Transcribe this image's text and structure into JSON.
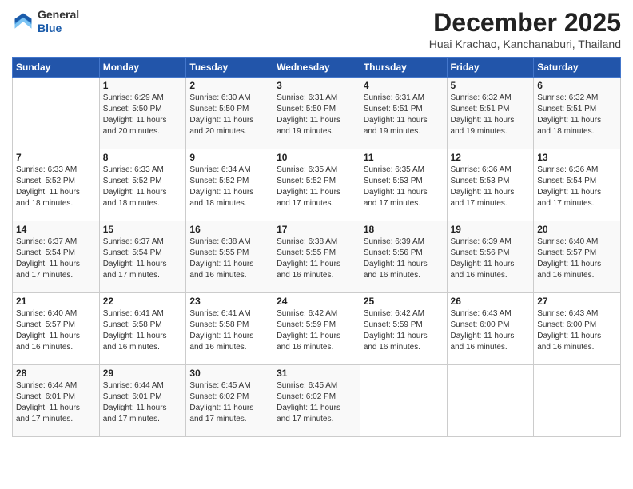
{
  "header": {
    "logo_general": "General",
    "logo_blue": "Blue",
    "month_title": "December 2025",
    "location": "Huai Krachao, Kanchanaburi, Thailand"
  },
  "days_of_week": [
    "Sunday",
    "Monday",
    "Tuesday",
    "Wednesday",
    "Thursday",
    "Friday",
    "Saturday"
  ],
  "weeks": [
    [
      {
        "day": "",
        "info": ""
      },
      {
        "day": "1",
        "info": "Sunrise: 6:29 AM\nSunset: 5:50 PM\nDaylight: 11 hours\nand 20 minutes."
      },
      {
        "day": "2",
        "info": "Sunrise: 6:30 AM\nSunset: 5:50 PM\nDaylight: 11 hours\nand 20 minutes."
      },
      {
        "day": "3",
        "info": "Sunrise: 6:31 AM\nSunset: 5:50 PM\nDaylight: 11 hours\nand 19 minutes."
      },
      {
        "day": "4",
        "info": "Sunrise: 6:31 AM\nSunset: 5:51 PM\nDaylight: 11 hours\nand 19 minutes."
      },
      {
        "day": "5",
        "info": "Sunrise: 6:32 AM\nSunset: 5:51 PM\nDaylight: 11 hours\nand 19 minutes."
      },
      {
        "day": "6",
        "info": "Sunrise: 6:32 AM\nSunset: 5:51 PM\nDaylight: 11 hours\nand 18 minutes."
      }
    ],
    [
      {
        "day": "7",
        "info": "Sunrise: 6:33 AM\nSunset: 5:52 PM\nDaylight: 11 hours\nand 18 minutes."
      },
      {
        "day": "8",
        "info": "Sunrise: 6:33 AM\nSunset: 5:52 PM\nDaylight: 11 hours\nand 18 minutes."
      },
      {
        "day": "9",
        "info": "Sunrise: 6:34 AM\nSunset: 5:52 PM\nDaylight: 11 hours\nand 18 minutes."
      },
      {
        "day": "10",
        "info": "Sunrise: 6:35 AM\nSunset: 5:52 PM\nDaylight: 11 hours\nand 17 minutes."
      },
      {
        "day": "11",
        "info": "Sunrise: 6:35 AM\nSunset: 5:53 PM\nDaylight: 11 hours\nand 17 minutes."
      },
      {
        "day": "12",
        "info": "Sunrise: 6:36 AM\nSunset: 5:53 PM\nDaylight: 11 hours\nand 17 minutes."
      },
      {
        "day": "13",
        "info": "Sunrise: 6:36 AM\nSunset: 5:54 PM\nDaylight: 11 hours\nand 17 minutes."
      }
    ],
    [
      {
        "day": "14",
        "info": "Sunrise: 6:37 AM\nSunset: 5:54 PM\nDaylight: 11 hours\nand 17 minutes."
      },
      {
        "day": "15",
        "info": "Sunrise: 6:37 AM\nSunset: 5:54 PM\nDaylight: 11 hours\nand 17 minutes."
      },
      {
        "day": "16",
        "info": "Sunrise: 6:38 AM\nSunset: 5:55 PM\nDaylight: 11 hours\nand 16 minutes."
      },
      {
        "day": "17",
        "info": "Sunrise: 6:38 AM\nSunset: 5:55 PM\nDaylight: 11 hours\nand 16 minutes."
      },
      {
        "day": "18",
        "info": "Sunrise: 6:39 AM\nSunset: 5:56 PM\nDaylight: 11 hours\nand 16 minutes."
      },
      {
        "day": "19",
        "info": "Sunrise: 6:39 AM\nSunset: 5:56 PM\nDaylight: 11 hours\nand 16 minutes."
      },
      {
        "day": "20",
        "info": "Sunrise: 6:40 AM\nSunset: 5:57 PM\nDaylight: 11 hours\nand 16 minutes."
      }
    ],
    [
      {
        "day": "21",
        "info": "Sunrise: 6:40 AM\nSunset: 5:57 PM\nDaylight: 11 hours\nand 16 minutes."
      },
      {
        "day": "22",
        "info": "Sunrise: 6:41 AM\nSunset: 5:58 PM\nDaylight: 11 hours\nand 16 minutes."
      },
      {
        "day": "23",
        "info": "Sunrise: 6:41 AM\nSunset: 5:58 PM\nDaylight: 11 hours\nand 16 minutes."
      },
      {
        "day": "24",
        "info": "Sunrise: 6:42 AM\nSunset: 5:59 PM\nDaylight: 11 hours\nand 16 minutes."
      },
      {
        "day": "25",
        "info": "Sunrise: 6:42 AM\nSunset: 5:59 PM\nDaylight: 11 hours\nand 16 minutes."
      },
      {
        "day": "26",
        "info": "Sunrise: 6:43 AM\nSunset: 6:00 PM\nDaylight: 11 hours\nand 16 minutes."
      },
      {
        "day": "27",
        "info": "Sunrise: 6:43 AM\nSunset: 6:00 PM\nDaylight: 11 hours\nand 16 minutes."
      }
    ],
    [
      {
        "day": "28",
        "info": "Sunrise: 6:44 AM\nSunset: 6:01 PM\nDaylight: 11 hours\nand 17 minutes."
      },
      {
        "day": "29",
        "info": "Sunrise: 6:44 AM\nSunset: 6:01 PM\nDaylight: 11 hours\nand 17 minutes."
      },
      {
        "day": "30",
        "info": "Sunrise: 6:45 AM\nSunset: 6:02 PM\nDaylight: 11 hours\nand 17 minutes."
      },
      {
        "day": "31",
        "info": "Sunrise: 6:45 AM\nSunset: 6:02 PM\nDaylight: 11 hours\nand 17 minutes."
      },
      {
        "day": "",
        "info": ""
      },
      {
        "day": "",
        "info": ""
      },
      {
        "day": "",
        "info": ""
      }
    ]
  ]
}
